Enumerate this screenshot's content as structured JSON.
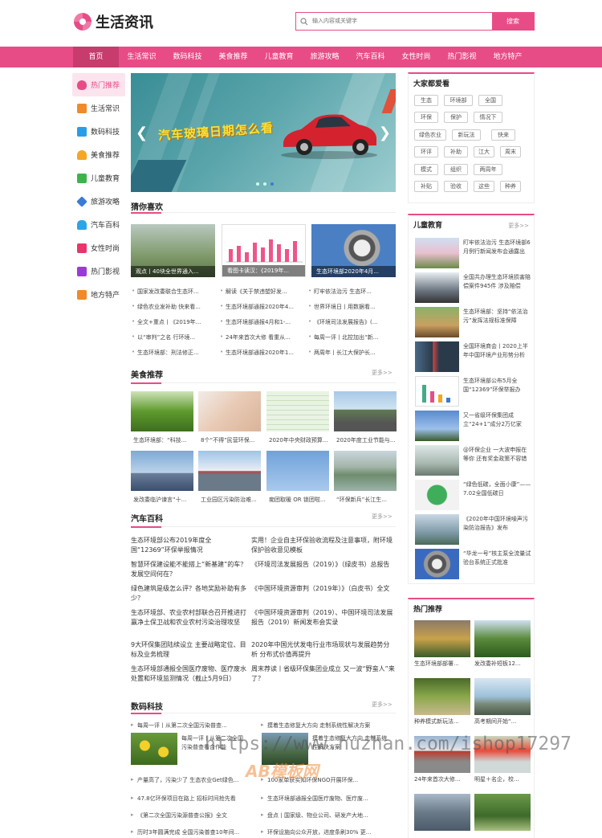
{
  "header": {
    "logo": "生活资讯",
    "search_placeholder": "输入内容或关键字",
    "search_button": "搜索"
  },
  "nav": [
    "首页",
    "生活常识",
    "数码科技",
    "美食推荐",
    "儿童教育",
    "旅游攻略",
    "汽车百科",
    "女性时尚",
    "热门影视",
    "地方特产"
  ],
  "leftnav": [
    {
      "label": "热门推荐",
      "icon": "flame-icon",
      "color": "#e84c86"
    },
    {
      "label": "生活常识",
      "icon": "home-icon",
      "color": "#f08a2a"
    },
    {
      "label": "数码科技",
      "icon": "camera-icon",
      "color": "#2a9de8"
    },
    {
      "label": "美食推荐",
      "icon": "food-icon",
      "color": "#f5a623"
    },
    {
      "label": "儿童教育",
      "icon": "graduation-icon",
      "color": "#3bb54a"
    },
    {
      "label": "旅游攻略",
      "icon": "plane-icon",
      "color": "#3a7bd5"
    },
    {
      "label": "汽车百科",
      "icon": "car-icon",
      "color": "#2aa6e8"
    },
    {
      "label": "女性时尚",
      "icon": "heel-icon",
      "color": "#e8366a"
    },
    {
      "label": "热门影视",
      "icon": "video-icon",
      "color": "#9b3bd5"
    },
    {
      "label": "地方特产",
      "icon": "box-icon",
      "color": "#f08a2a"
    }
  ],
  "banner": {
    "title": "汽车玻璃日期怎么看"
  },
  "guess": {
    "title": "猜你喜欢",
    "thumbs": [
      "观点丨40块全世界通入...",
      "看图卡读汉：《2019年...",
      "生态环境部2020年4月..."
    ],
    "list": [
      [
        "国家发改委联合生态环...",
        "解读《关于禁违塑好发...",
        "盯牢依法治污 生态环..."
      ],
      [
        "绿色农业发补助 快来看...",
        "生态环境部通报2020年4...",
        "世界环境日丨用数据看..."
      ],
      [
        "全文+重点丨《2019年...",
        "生态环境部通报4月和1-...",
        "《环境司法发展报告》(..."
      ],
      [
        "以“审判”之名 行环境...",
        "24年来首次大修 看重从...",
        "每周一评丨北控加出“新..."
      ],
      [
        "生态环境部：刑法修正...",
        "生态环境部通报2020年1...",
        "两周年丨长江大保护长..."
      ]
    ]
  },
  "food": {
    "title": "美食推荐",
    "more": "更多>>",
    "items": [
      "生态环境部：“科技...",
      "8个“不得”民营环保...",
      "2020年中央财政预算...",
      "2020年度工业节能与...",
      "发改委临沪谏言“十...",
      "工业园区污染防治难...",
      "痴团取暖 OR 锁团啦...",
      "“环保新兵”长江生..."
    ]
  },
  "auto": {
    "title": "汽车百科",
    "more": "更多>>",
    "left": [
      "生态环境部公布2019年度全国“12369”环保举报情况",
      "智慧环保建设能不能搭上“新基建”的车？发展空间何在？",
      "绿色建筑是级怎么评？各地奖励补助有多少？",
      "生态环境部、农业农村部联合召开推进打赢净土保卫战和农业农村污染治理攻坚",
      "9大环保集团陆续设立 主要战略定位、目标及业务梳理",
      "生态环境部通报全国医疗废物、医疗废水处置和环境监测情况（截止5月9日）"
    ],
    "right": [
      "实用！企业自主环保验收流程及注意事项，附环境保护验收意见模板",
      "《环境司法发展报告（2019）》（绿皮书）总报告",
      "《中国环境资源审判（2019年）》（白皮书）全文",
      "《中国环境资源审判（2019）、中国环境司法发展报告（2019）新闻发布会实录",
      "2020年中国光伏发电行业市场现状与发展趋势分析 分布式价值再提升",
      "周末荐读丨省级环保集团业成立 又一波“野蛮人”来了？"
    ]
  },
  "digital": {
    "title": "数码科技",
    "more": "更多>>",
    "top": [
      "每周一评丨从第二次全国污染普查...",
      "摸着生态修复大方向 走制系统性解决方案"
    ],
    "feature_left": "每周一评丨从第二次全国污染普查看合作能",
    "feature_right": "摸着生态修复大方向 走制系统性解决方案",
    "list": [
      "产量高了，污染少了 生态农业Get绿色...",
      "100家单获实知环保NGO开展环保...",
      "47.8亿环保项目在路上 招标时间抢先看",
      "生态环境部通报全国医疗废物、医疗废...",
      "《第二次全国污染源普查公报》全文",
      "盘点丨国家级、物业公司、研发产大地...",
      "历时3年圆满完成 全国污染普查10年间...",
      "环保设施向公众开放，进度条刷30% 更..."
    ]
  },
  "favorites": {
    "title": "大家都爱看",
    "tags": [
      [
        "生态",
        "环境部",
        "全国"
      ],
      [
        "环保",
        "保护",
        "情况下"
      ],
      [
        "绿色农业",
        "新玩法",
        "快来"
      ],
      [
        "环评",
        "补助",
        "江大",
        "周末"
      ],
      [
        "模式",
        "组织",
        "两周年"
      ],
      [
        "补贴",
        "验收",
        "这些",
        "种养"
      ]
    ]
  },
  "kids": {
    "title": "儿童教育",
    "more": "更多>>",
    "items": [
      "盯牢依法治污 生态环境部6月例行新闻发布会通露出",
      "全国共办理生态环境损害赔偿案件945件 涉及赔偿",
      "生态环境部：坚持“依法治污”发挥法规标准保障",
      "全国环境商会丨2020上半年中国环境产业形势分析",
      "生态环境部公布5月全国“12369”环保举报办",
      "又一省级环保集团成立“24+1”成分2万亿家",
      "@环保企业 一大波申报在等你 还有奖金政策不容错",
      "“绿色低碳，全面小康”——7.02全国低碳日",
      "《2020年中国环境噪声污染防治报告》发布",
      "“华龙一号”核主泵全流量试验台系统正式批准"
    ]
  },
  "hot": {
    "title": "热门推荐",
    "items": [
      "生态环境部部署...",
      "发改委补短板12...",
      "种养模式新玩法...",
      "高考期间开始“...",
      "24年来首次大修...",
      "明星＋名企，校...",
      "",
      ""
    ]
  },
  "watermark": "https://www.huzhan.com/ishop17297",
  "watermark_logo": "AB模板网"
}
